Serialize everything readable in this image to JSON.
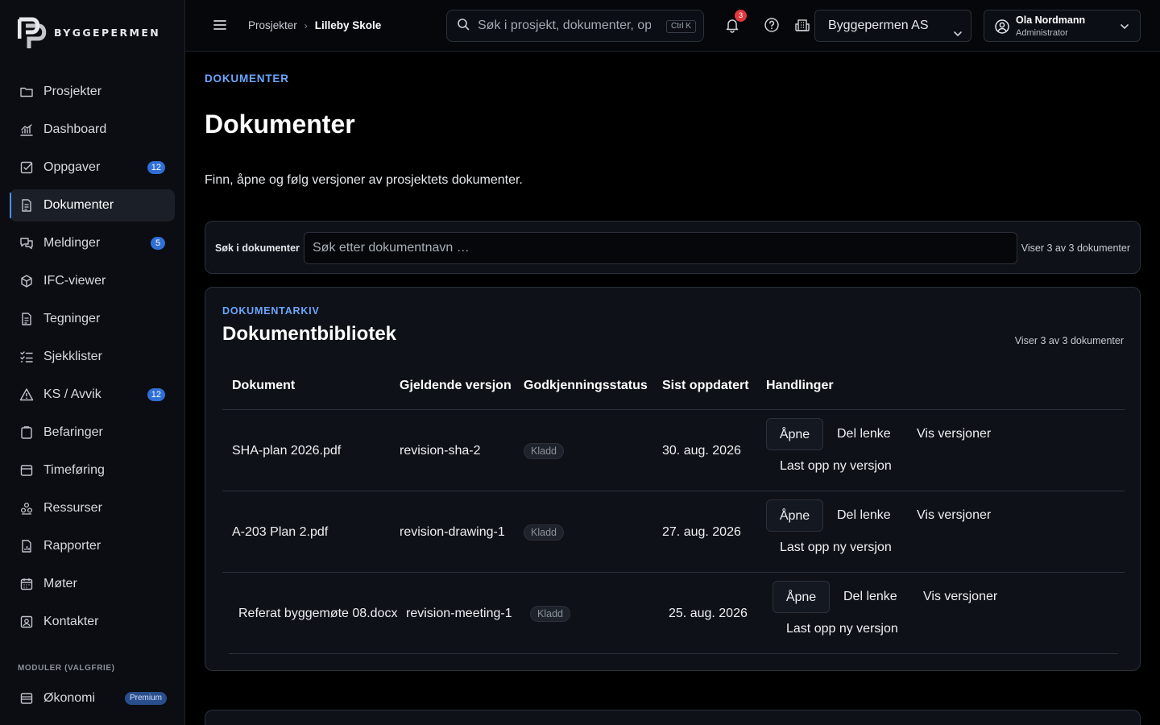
{
  "brand": {
    "name": "BYGGEPERMEN"
  },
  "sidebar": {
    "items": [
      {
        "label": "Prosjekter",
        "icon": "folder-icon"
      },
      {
        "label": "Dashboard",
        "icon": "chart-icon"
      },
      {
        "label": "Oppgaver",
        "icon": "checkbox-icon",
        "badge": "12"
      },
      {
        "label": "Dokumenter",
        "icon": "document-icon",
        "active": true
      },
      {
        "label": "Meldinger",
        "icon": "chat-icon",
        "badge": "5"
      },
      {
        "label": "IFC-viewer",
        "icon": "cube-icon"
      },
      {
        "label": "Tegninger",
        "icon": "document-icon"
      },
      {
        "label": "Sjekklister",
        "icon": "checklist-icon"
      },
      {
        "label": "KS / Avvik",
        "icon": "warning-icon",
        "badge": "12"
      },
      {
        "label": "Befaringer",
        "icon": "clipboard-icon"
      },
      {
        "label": "Timeføring",
        "icon": "timesheet-icon"
      },
      {
        "label": "Ressurser",
        "icon": "resources-icon"
      },
      {
        "label": "Rapporter",
        "icon": "report-icon"
      },
      {
        "label": "Møter",
        "icon": "calendar-icon"
      },
      {
        "label": "Kontakter",
        "icon": "contact-icon"
      }
    ],
    "modules_heading": "MODULER (VALGFRIE)",
    "modules": [
      {
        "label": "Økonomi",
        "icon": "wallet-icon",
        "badge": "Premium"
      }
    ]
  },
  "topbar": {
    "breadcrumb": [
      "Prosjekter",
      "Lilleby Skole"
    ],
    "search_placeholder": "Søk i prosjekt, dokumenter, oppgaver",
    "search_shortcut": "Ctrl K",
    "notifications_count": "3",
    "company": "Byggepermen AS",
    "user": {
      "name": "Ola Nordmann",
      "role": "Administrator"
    }
  },
  "page": {
    "eyebrow": "DOKUMENTER",
    "title": "Dokumenter",
    "description": "Finn, åpne og følg versjoner av prosjektets dokumenter."
  },
  "filter": {
    "label": "Søk i dokumenter",
    "placeholder": "Søk etter dokumentnavn …",
    "count_text": "Viser 3 av 3 dokumenter"
  },
  "library": {
    "eyebrow": "DOKUMENTARKIV",
    "title": "Dokumentbibliotek",
    "count_text": "Viser 3 av 3 dokumenter",
    "columns": [
      "Dokument",
      "Gjeldende versjon",
      "Godkjenningsstatus",
      "Sist oppdatert",
      "Handlinger"
    ],
    "actions": {
      "open": "Åpne",
      "share": "Del lenke",
      "versions": "Vis versjoner",
      "upload": "Last opp ny versjon"
    },
    "rows": [
      {
        "document": "SHA-plan 2026.pdf",
        "version": "revision-sha-2",
        "status": "Kladd",
        "updated": "30. aug. 2026"
      },
      {
        "document": "A-203 Plan 2.pdf",
        "version": "revision-drawing-1",
        "status": "Kladd",
        "updated": "27. aug. 2026"
      },
      {
        "document": "Referat byggemøte 08.docx",
        "version": "revision-meeting-1",
        "status": "Kladd",
        "updated": "25. aug. 2026"
      }
    ]
  },
  "colors": {
    "accent": "#6aa6ff",
    "badge": "#2f6fd6",
    "notification": "#e0393e",
    "background": "#000000"
  }
}
